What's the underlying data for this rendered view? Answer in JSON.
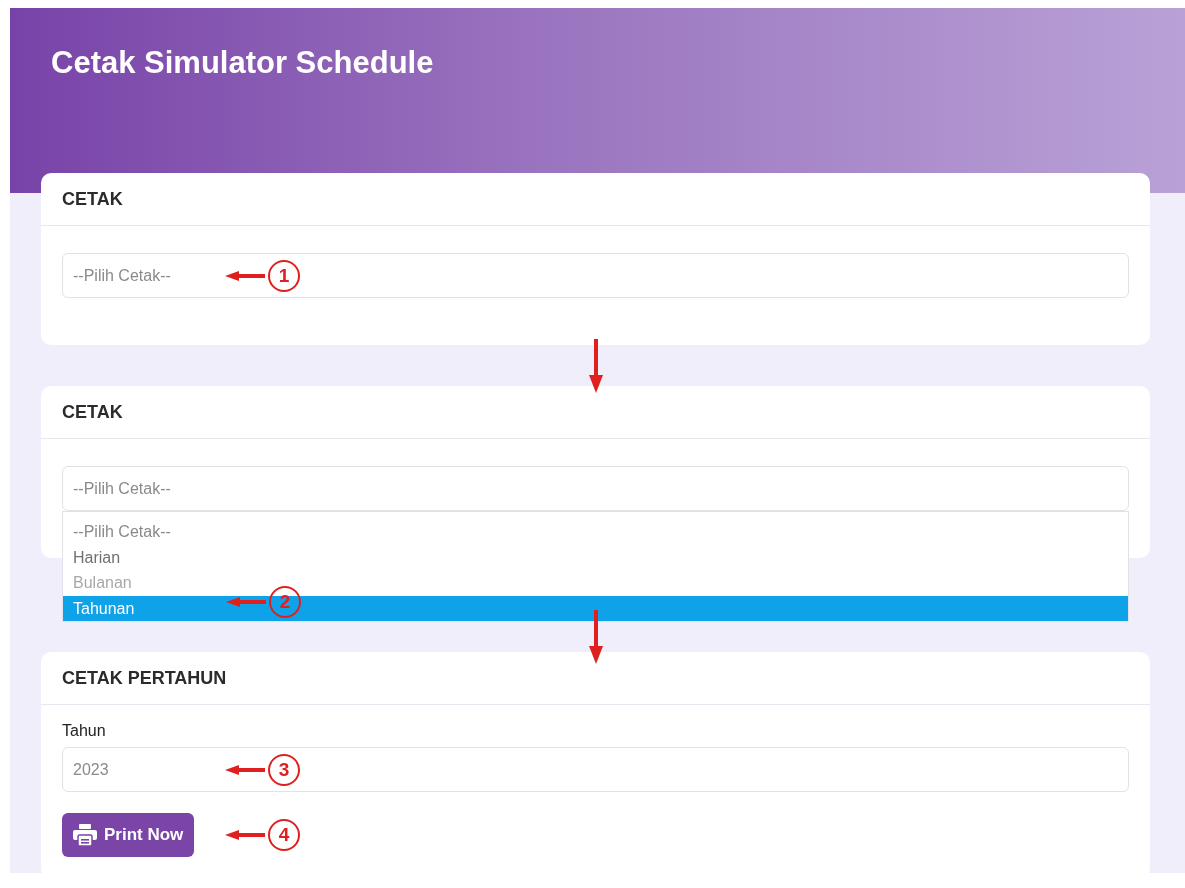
{
  "header": {
    "title": "Cetak Simulator Schedule"
  },
  "cards": [
    {
      "title": "CETAK",
      "select": {
        "placeholder": "--Pilih Cetak--",
        "callout": "1"
      }
    },
    {
      "title": "CETAK",
      "select": {
        "placeholder": "--Pilih Cetak--"
      },
      "dropdown": {
        "options": [
          {
            "label": "--Pilih Cetak--",
            "selected": false,
            "disabled": false,
            "kind": "hint"
          },
          {
            "label": "Harian",
            "selected": false,
            "disabled": false,
            "kind": "option"
          },
          {
            "label": "Bulanan",
            "selected": false,
            "disabled": true,
            "kind": "option"
          },
          {
            "label": "Tahunan",
            "selected": true,
            "disabled": false,
            "kind": "option",
            "callout": "2"
          }
        ]
      }
    },
    {
      "title": "CETAK PERTAHUN",
      "field": {
        "label": "Tahun",
        "value": "2023",
        "callout": "3"
      },
      "button": {
        "label": "Print Now",
        "callout": "4"
      }
    }
  ]
}
